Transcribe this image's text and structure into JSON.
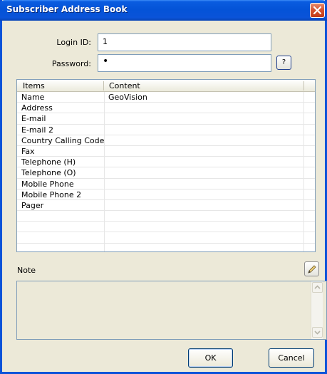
{
  "window": {
    "title": "Subscriber Address Book"
  },
  "form": {
    "login_label": "Login ID:",
    "login_value": "1",
    "password_label": "Password:",
    "password_value": "•",
    "help_label": "?"
  },
  "grid": {
    "headers": [
      "Items",
      "Content"
    ],
    "rows": [
      {
        "item": "Name",
        "content": "GeoVision"
      },
      {
        "item": "Address",
        "content": ""
      },
      {
        "item": "E-mail",
        "content": ""
      },
      {
        "item": "E-mail 2",
        "content": ""
      },
      {
        "item": "Country Calling Code",
        "content": ""
      },
      {
        "item": "Fax",
        "content": ""
      },
      {
        "item": "Telephone (H)",
        "content": ""
      },
      {
        "item": "Telephone (O)",
        "content": ""
      },
      {
        "item": "Mobile Phone",
        "content": ""
      },
      {
        "item": "Mobile Phone 2",
        "content": ""
      },
      {
        "item": "Pager",
        "content": ""
      },
      {
        "item": "",
        "content": ""
      },
      {
        "item": "",
        "content": ""
      },
      {
        "item": "",
        "content": ""
      }
    ]
  },
  "note": {
    "label": "Note",
    "value": ""
  },
  "buttons": {
    "ok": "OK",
    "cancel": "Cancel"
  },
  "icons": {
    "close": "close-icon",
    "edit": "pencil-icon",
    "scroll_up": "chevron-up-icon",
    "scroll_down": "chevron-down-icon"
  },
  "colors": {
    "titlebar": "#0a53d9",
    "close": "#d4502d",
    "face": "#ece9d8"
  }
}
